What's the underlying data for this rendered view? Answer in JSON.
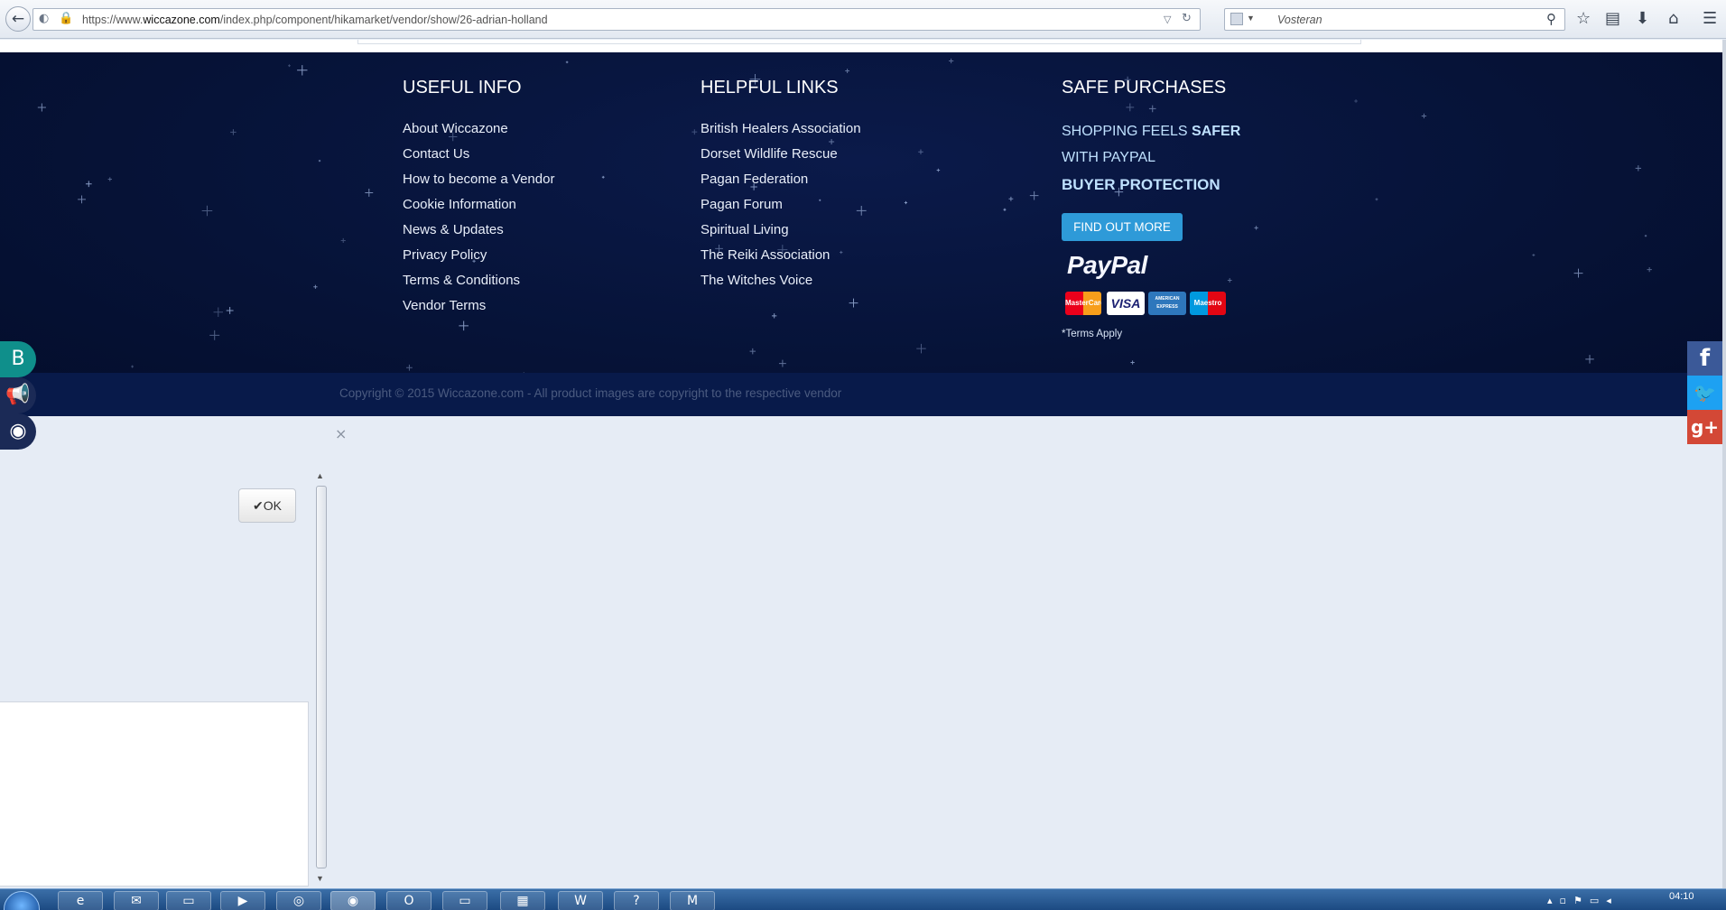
{
  "browser": {
    "url_prefix": "https://www.",
    "url_domain": "wiccazone.com",
    "url_path": "/index.php/component/hikamarket/vendor/show/26-adrian-holland",
    "search_value": "Vosteran",
    "icons": [
      "back-icon",
      "site-info-icon",
      "lock-icon",
      "dropdown-icon",
      "reload-icon",
      "search-engine-icon",
      "search-icon",
      "bookmark-star-icon",
      "reading-list-icon",
      "download-icon",
      "home-icon",
      "menu-icon"
    ]
  },
  "footer": {
    "useful_info": {
      "title": "USEFUL INFO",
      "links": [
        "About Wiccazone",
        "Contact Us",
        "How to become a Vendor",
        "Cookie Information",
        "News & Updates",
        "Privacy Policy",
        "Terms & Conditions",
        "Vendor Terms"
      ]
    },
    "helpful_links": {
      "title": "HELPFUL LINKS",
      "links": [
        "British Healers Association",
        "Dorset Wildlife Rescue",
        "Pagan Federation",
        "Pagan Forum",
        "Spiritual Living",
        "The Reiki Association",
        "The Witches Voice"
      ]
    },
    "safe_purchases": {
      "title": "SAFE PURCHASES",
      "line1_prefix": "SHOPPING FEELS ",
      "line1_bold": "SAFER",
      "line2": "WITH PAYPAL",
      "line3": "BUYER PROTECTION",
      "button": "FIND OUT MORE",
      "paypal": "PayPal",
      "cards": [
        "MasterCard",
        "VISA",
        "AMERICAN EXPRESS",
        "Maestro"
      ],
      "terms": "*Terms Apply"
    },
    "copyright": "Copyright © 2015 Wiccazone.com - All product images are copyright to the respective vendor"
  },
  "social_left": [
    "blogger-icon",
    "megaphone-icon",
    "rss-icon"
  ],
  "social_right": [
    "facebook-icon",
    "twitter-icon",
    "google-plus-icon"
  ],
  "modal": {
    "close": "×",
    "ok_check": "✔",
    "ok_label": "OK"
  },
  "taskbar": {
    "clock": "04:10",
    "apps": [
      "internet-explorer-icon",
      "outlook-icon",
      "file-explorer-icon",
      "media-player-icon",
      "chrome-icon",
      "firefox-icon",
      "opera-icon",
      "folder-icon",
      "archive-icon",
      "word-icon",
      "help-icon",
      "gmail-icon"
    ]
  },
  "colors": {
    "footer_bg": "#061338",
    "accent_button": "#2e9ad8",
    "facebook": "#3b5998",
    "twitter": "#1da1f2",
    "google_plus": "#d34836",
    "blogger_teal": "#0f8f8b"
  }
}
